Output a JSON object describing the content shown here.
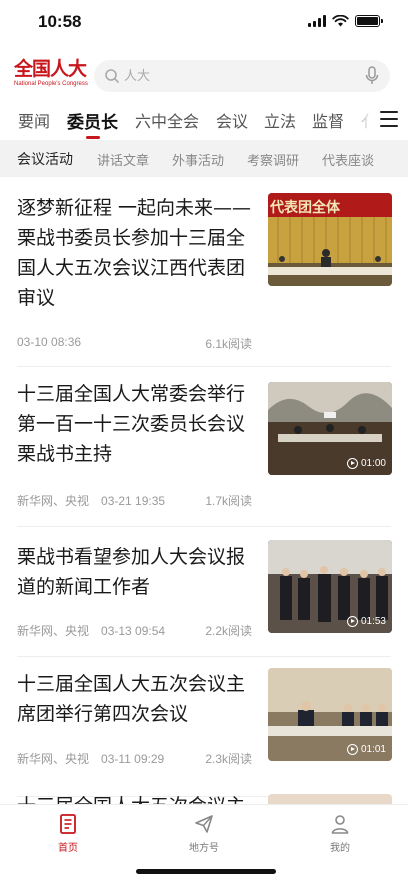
{
  "status_bar": {
    "time": "10:58"
  },
  "header": {
    "logo_cn": "全国人大",
    "logo_en": "National People's Congress",
    "search_placeholder": "人大"
  },
  "tabs": [
    {
      "label": "要闻",
      "active": false
    },
    {
      "label": "委员长",
      "active": true
    },
    {
      "label": "六中全会",
      "active": false
    },
    {
      "label": "会议",
      "active": false
    },
    {
      "label": "立法",
      "active": false
    },
    {
      "label": "监督",
      "active": false
    },
    {
      "label": "亻",
      "active": false
    }
  ],
  "subtabs": [
    {
      "label": "会议活动",
      "active": true
    },
    {
      "label": "讲话文章",
      "active": false
    },
    {
      "label": "外事活动",
      "active": false
    },
    {
      "label": "考察调研",
      "active": false
    },
    {
      "label": "代表座谈",
      "active": false
    }
  ],
  "articles": [
    {
      "title": "逐梦新征程 一起向未来——栗战书委员长参加十三届全国人大五次会议江西代表团审议",
      "source": "",
      "time": "03-10 08:36",
      "reads": "6.1k阅读",
      "thumb_banner": "代表团全体",
      "duration": ""
    },
    {
      "title": "十三届全国人大常委会举行第一百一十三次委员长会议 栗战书主持",
      "source": "新华网、央视",
      "time": "03-21 19:35",
      "reads": "1.7k阅读",
      "thumb_banner": "",
      "duration": "01:00"
    },
    {
      "title": "栗战书看望参加人大会议报道的新闻工作者",
      "source": "新华网、央视",
      "time": "03-13 09:54",
      "reads": "2.2k阅读",
      "thumb_banner": "",
      "duration": "01:53"
    },
    {
      "title": "十三届全国人大五次会议主席团举行第四次会议",
      "source": "新华网、央视",
      "time": "03-11 09:29",
      "reads": "2.3k阅读",
      "thumb_banner": "",
      "duration": "01:01"
    },
    {
      "title": "十三届全国人大五次会议主",
      "source": "",
      "time": "",
      "reads": "",
      "thumb_banner": "",
      "duration": ""
    }
  ],
  "bottom_nav": [
    {
      "label": "首页",
      "icon": "home-news-icon",
      "active": true
    },
    {
      "label": "地方号",
      "icon": "paper-plane-icon",
      "active": false
    },
    {
      "label": "我的",
      "icon": "person-icon",
      "active": false
    }
  ],
  "colors": {
    "accent": "#c8161d",
    "subtab_bg": "#f2f2f2",
    "meta": "#9a9a9a"
  }
}
